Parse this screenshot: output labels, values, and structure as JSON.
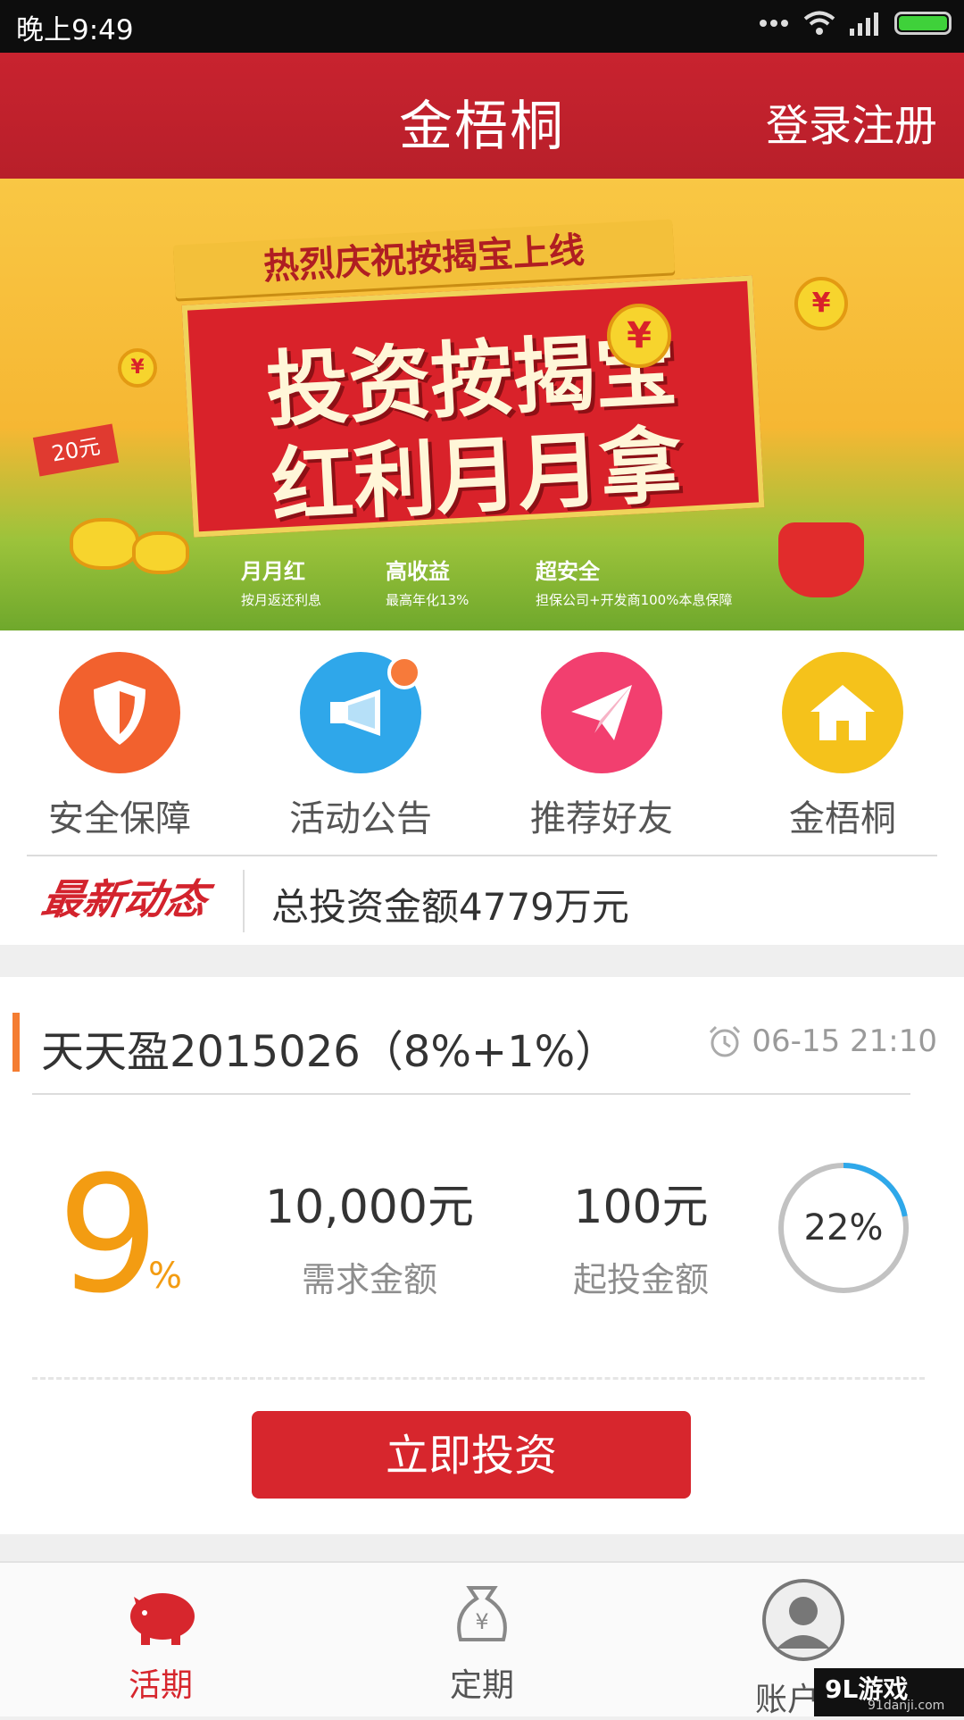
{
  "status_bar": {
    "time": "晚上9:49"
  },
  "header": {
    "title": "金梧桐",
    "login_register": "登录注册"
  },
  "banner": {
    "ribbon": "热烈庆祝按揭宝上线",
    "headline_1": "投资按揭宝",
    "headline_2": "红利月月拿",
    "tag": "20元",
    "features": [
      {
        "title": "月月红",
        "sub": "按月返还利息"
      },
      {
        "title": "高收益",
        "sub": "最高年化13%"
      },
      {
        "title": "超安全",
        "sub": "担保公司+开发商100%本息保障"
      }
    ]
  },
  "shortcuts": [
    {
      "label": "安全保障",
      "icon": "shield-icon",
      "color": "#f2612e"
    },
    {
      "label": "活动公告",
      "icon": "megaphone-icon",
      "color": "#2fa7ea"
    },
    {
      "label": "推荐好友",
      "icon": "paper-plane-icon",
      "color": "#f23f6f"
    },
    {
      "label": "金梧桐",
      "icon": "house-icon",
      "color": "#f5c21b"
    }
  ],
  "news": {
    "badge": "最新动态",
    "text": "总投资金额4779万元"
  },
  "product": {
    "title": "天天盈2015026（8%+1%）",
    "time": "06-15 21:10",
    "rate": "9",
    "rate_unit": "%",
    "required_amount": "10,000元",
    "required_label": "需求金额",
    "min_amount": "100元",
    "min_label": "起投金额",
    "progress_text": "22%",
    "progress": 0.22,
    "invest_button": "立即投资"
  },
  "tabbar": [
    {
      "label": "活期",
      "icon": "piggy-bank-icon",
      "active": true
    },
    {
      "label": "定期",
      "icon": "money-bag-icon",
      "active": false
    },
    {
      "label": "账户管",
      "icon": "user-avatar-icon",
      "active": false
    }
  ],
  "watermark": {
    "title": "9L游戏",
    "sub": "91danji.com"
  },
  "colors": {
    "brand_red": "#c8232f",
    "accent_orange": "#f39c12",
    "ring_blue": "#2ea8ea"
  }
}
